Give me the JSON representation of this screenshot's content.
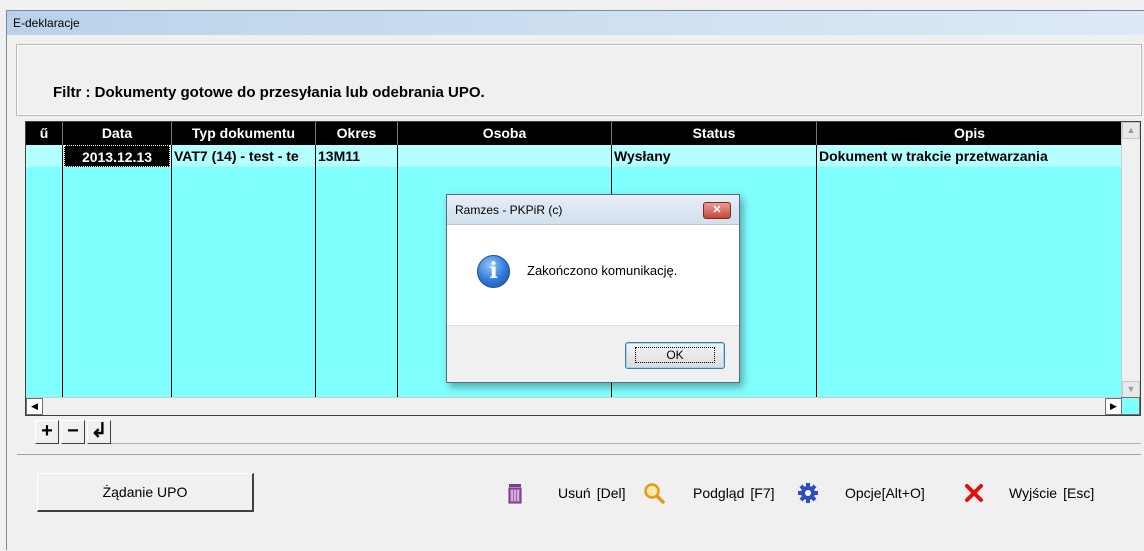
{
  "window": {
    "title": "E-deklaracje"
  },
  "filter": {
    "text": "Filtr : Dokumenty gotowe do przesyłania lub odebrania UPO."
  },
  "grid": {
    "columns": [
      "ű",
      "Data",
      "Typ dokumentu",
      "Okres",
      "Osoba",
      "Status",
      "Opis"
    ],
    "rows": [
      {
        "data": "2013.12.13",
        "typ": "VAT7 (14) - test - te",
        "okres": "13M11",
        "osoba": "",
        "status": "Wysłany",
        "opis": "Dokument w trakcie przetwarzania"
      }
    ],
    "row_highlight_color": "#b4ffff",
    "grid_bg_color": "#80ffff"
  },
  "nav": {
    "add": "+",
    "remove": "−",
    "post": "↲"
  },
  "buttons": {
    "upo": {
      "label": "Żądanie UPO"
    },
    "usun": {
      "label": "Usuń",
      "key": "[Del]",
      "icon": "trash-icon"
    },
    "podglad": {
      "label": "Podgląd",
      "key": "[F7]",
      "icon": "magnifier-icon"
    },
    "opcje": {
      "label": "Opcje[Alt+O]",
      "icon": "gear-icon"
    },
    "wyjscie": {
      "label": "Wyjście",
      "key": "[Esc]",
      "icon": "red-x-icon"
    }
  },
  "dialog": {
    "title": "Ramzes - PKPiR (c)",
    "close": "✕",
    "message": "Zakończono komunikację.",
    "ok": "OK",
    "icon": "info-icon"
  }
}
